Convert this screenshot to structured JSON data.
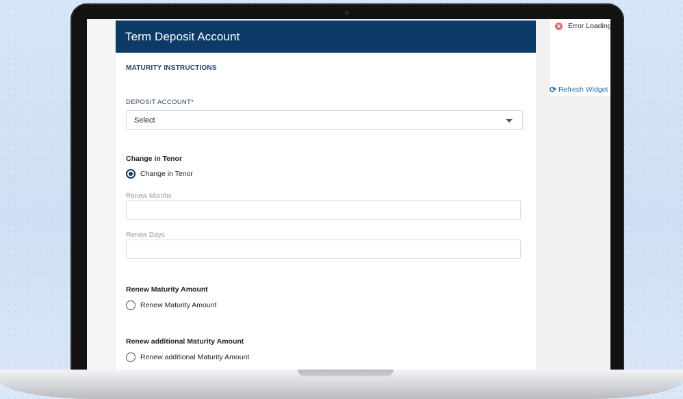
{
  "card": {
    "title": "Term Deposit Account",
    "section_title": "MATURITY INSTRUCTIONS",
    "deposit_account": {
      "label": "DEPOSIT ACCOUNT*",
      "selected": "Select"
    },
    "change_in_tenor": {
      "group_title": "Change in Tenor",
      "option_label": "Change in Tenor",
      "checked": true,
      "renew_months_label": "Renew Months",
      "renew_months_value": "",
      "renew_days_label": "Renew Days",
      "renew_days_value": ""
    },
    "renew_maturity": {
      "group_title": "Renew Maturity Amount",
      "option_label": "Renew Maturity Amount",
      "checked": false
    },
    "renew_additional": {
      "group_title": "Renew additional Maturity Amount",
      "option_label": "Renew additional Maturity Amount",
      "checked": false
    }
  },
  "widget": {
    "error_text": "Error Loading",
    "refresh_label": "Refresh Widget"
  },
  "colors": {
    "header_bg": "#0e3a68",
    "radio_accent": "#0e3a68",
    "link": "#2a6fb5",
    "error": "#e06a6a"
  }
}
